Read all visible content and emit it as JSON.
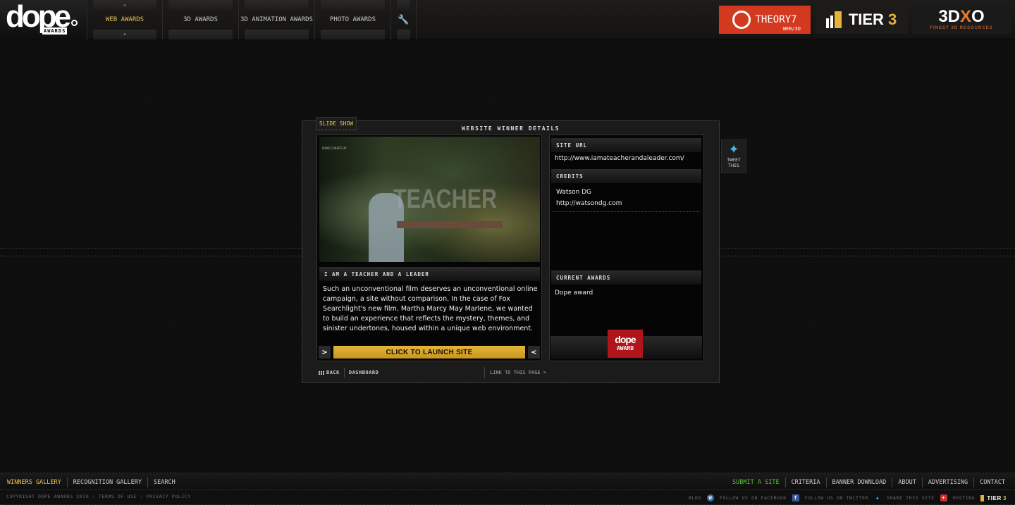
{
  "header": {
    "logo": {
      "word": "dope",
      "sub": "AWARDS"
    },
    "nav": [
      {
        "label": "WEB AWARDS",
        "active": true
      },
      {
        "label": "3D AWARDS",
        "active": false
      },
      {
        "label": "3D ANIMATION AWARDS",
        "active": false
      },
      {
        "label": "PHOTO AWARDS",
        "active": false
      }
    ],
    "tools_icon": "wrench-icon",
    "sponsors": {
      "theory7": {
        "name": "THEORY7",
        "tag": "WEB/3D"
      },
      "tier3": {
        "name": "TIER",
        "num": "3"
      },
      "threedx": {
        "name": "3D",
        "x": "X",
        "o": "O",
        "tag": "FINEST 3D RESOURCES"
      }
    }
  },
  "panel": {
    "tab_label": "SLIDE SHOW",
    "title": "WEBSITE WINNER DETAILS",
    "screenshot": {
      "overlay_word": "TEACHER",
      "mini_text": "DARK FOREST.UP"
    },
    "site_name": "I AM A TEACHER AND A LEADER",
    "description": "Such an unconventional film deserves an unconventional online campaign, a site without comparison. In the case of Fox Searchlight's new film, Martha Marcy May Marlene, we wanted to build an experience that reflects the mystery, themes, and sinister undertones, housed within a unique web environment.",
    "launch_label": "CLICK TO LAUNCH SITE",
    "prev_arrow": ">",
    "next_arrow": "<",
    "site_url_label": "SITE URL",
    "site_url": "http://www.iamateacherandaleader.com/",
    "credits_label": "CREDITS",
    "credits": [
      "Watson DG",
      "http://watsondg.com"
    ],
    "awards_label": "CURRENT AWARDS",
    "awards": [
      "Dope award"
    ],
    "award_badge": {
      "word": "dope",
      "label": "AWARD"
    },
    "back_label": "BACK",
    "dashboard_label": "DASHBOARD",
    "link_label": "LINK TO THIS PAGE >"
  },
  "tweet": {
    "bird": "❀",
    "label_line1": "TWEET",
    "label_line2": "THIS"
  },
  "footer": {
    "left_nav": [
      "WINNERS GALLERY",
      "RECOGNITION GALLERY",
      "SEARCH"
    ],
    "right_nav": [
      "SUBMIT A SITE",
      "CRITERIA",
      "BANNER DOWNLOAD",
      "ABOUT",
      "ADVERTISING",
      "CONTACT"
    ],
    "copyright": "COPYRIGHT DOPE AWARDS 2010",
    "terms": "TERMS OF USE",
    "privacy": "PRIVACY POLICY",
    "social": {
      "blog": "BLOG",
      "facebook": "FOLLOW US ON FACEBOOK",
      "twitter": "FOLLOW US ON TWITTER",
      "share": "SHARE THIS SITE",
      "hosting": "HOSTING",
      "host_name": "TIER",
      "host_num": "3"
    }
  }
}
